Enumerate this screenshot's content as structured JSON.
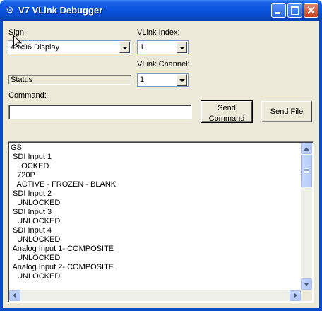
{
  "window": {
    "title": "V7 VLink Debugger",
    "app_icon": "app-icon"
  },
  "sign": {
    "label": "Sign:",
    "selected": "48x96 Display"
  },
  "vlink_index": {
    "label": "VLink Index:",
    "selected": "1"
  },
  "vlink_channel": {
    "label": "VLink Channel:",
    "selected": "1"
  },
  "status": {
    "text": "Status"
  },
  "command": {
    "label": "Command:",
    "value": ""
  },
  "buttons": {
    "send_command_line1": "Send",
    "send_command_line2": "Command",
    "send_file": "Send File"
  },
  "output": {
    "lines": [
      "GS",
      " SDI Input 1",
      "   LOCKED",
      "   720P",
      "   ACTIVE - FROZEN - BLANK",
      " SDI Input 2",
      "   UNLOCKED",
      " SDI Input 3",
      "   UNLOCKED",
      " SDI Input 4",
      "   UNLOCKED",
      " Analog Input 1- COMPOSITE",
      "   UNLOCKED",
      " Analog Input 2- COMPOSITE",
      "   UNLOCKED"
    ]
  },
  "colors": {
    "titlebar": "#0a55e0",
    "window_face": "#ece9d8",
    "close_button": "#c8401e"
  }
}
